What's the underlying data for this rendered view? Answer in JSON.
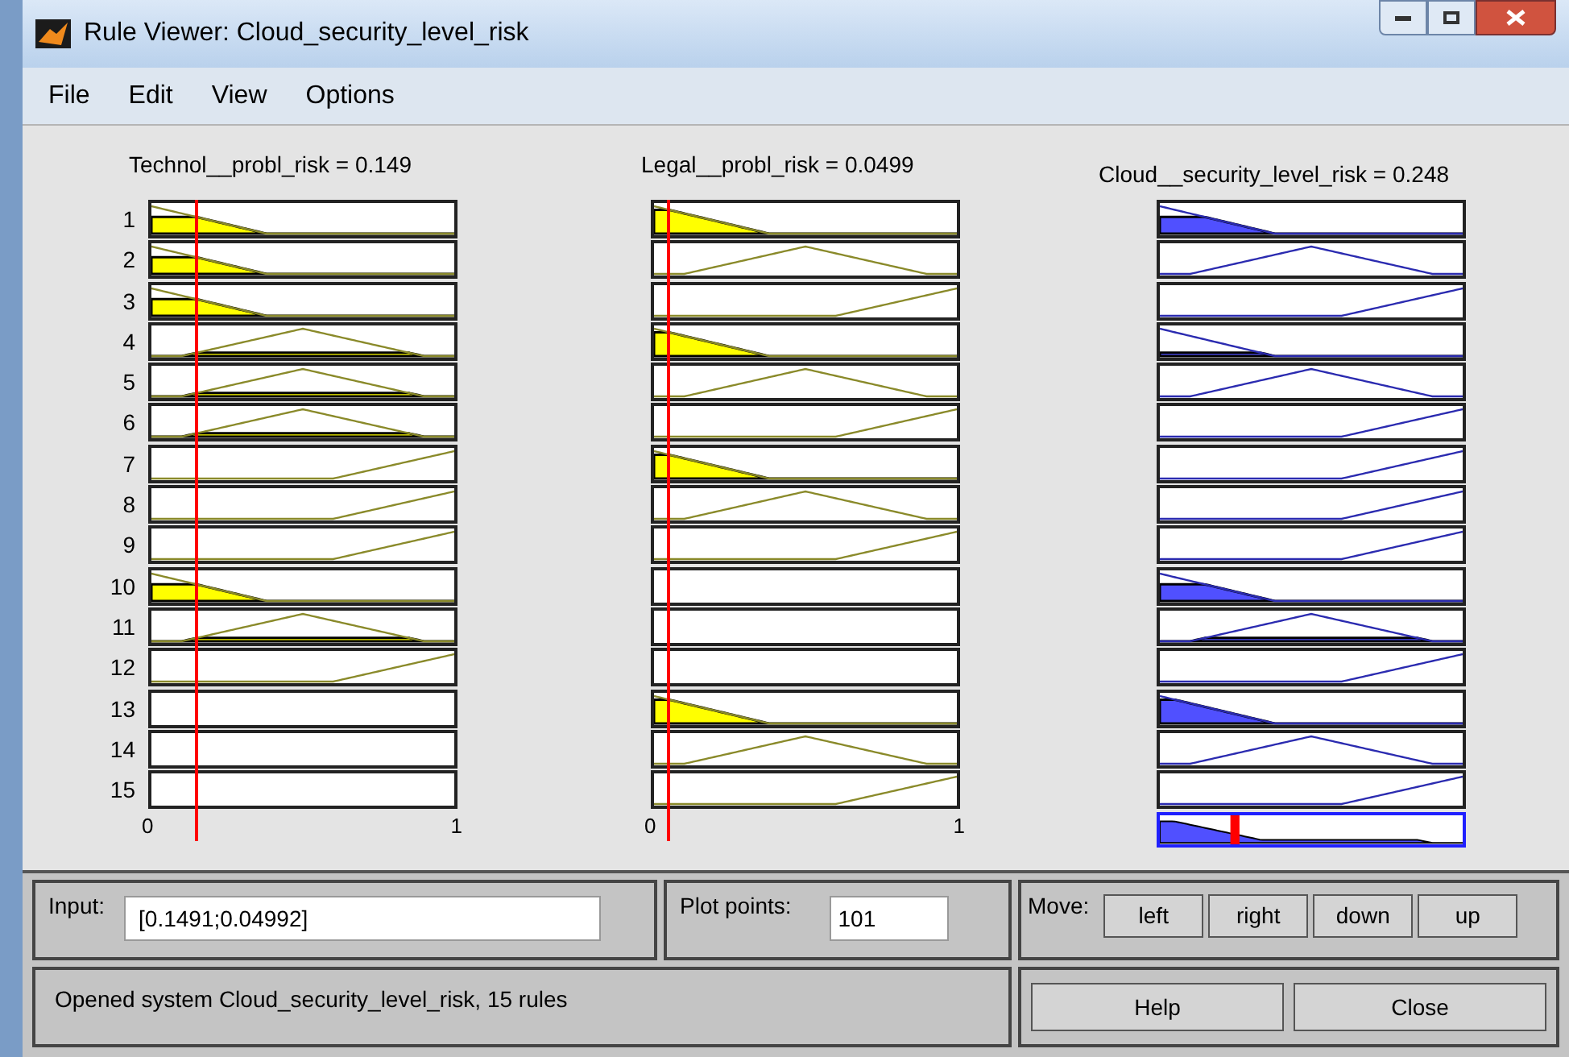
{
  "window": {
    "title": "Rule Viewer: Cloud_security_level_risk"
  },
  "menu": [
    "File",
    "Edit",
    "View",
    "Options"
  ],
  "variables": [
    {
      "title": "Technol__probl_risk = 0.149",
      "kind": "input"
    },
    {
      "title": "Legal__probl_risk = 0.0499",
      "kind": "input"
    },
    {
      "title": "Cloud__security_level_risk = 0.248",
      "kind": "output"
    }
  ],
  "rules": [
    {
      "number": "1",
      "cells": [
        {
          "kind": "low"
        },
        {
          "kind": "low"
        },
        {
          "kind": "low"
        }
      ]
    },
    {
      "number": "2",
      "cells": [
        {
          "kind": "low"
        },
        {
          "kind": "mid"
        },
        {
          "kind": "mid"
        }
      ]
    },
    {
      "number": "3",
      "cells": [
        {
          "kind": "low"
        },
        {
          "kind": "high"
        },
        {
          "kind": "high"
        }
      ]
    },
    {
      "number": "4",
      "cells": [
        {
          "kind": "mid"
        },
        {
          "kind": "low"
        },
        {
          "kind": "low"
        }
      ]
    },
    {
      "number": "5",
      "cells": [
        {
          "kind": "mid"
        },
        {
          "kind": "mid"
        },
        {
          "kind": "mid"
        }
      ]
    },
    {
      "number": "6",
      "cells": [
        {
          "kind": "mid"
        },
        {
          "kind": "high"
        },
        {
          "kind": "high"
        }
      ]
    },
    {
      "number": "7",
      "cells": [
        {
          "kind": "high"
        },
        {
          "kind": "low"
        },
        {
          "kind": "high"
        }
      ]
    },
    {
      "number": "8",
      "cells": [
        {
          "kind": "high"
        },
        {
          "kind": "mid"
        },
        {
          "kind": "high"
        }
      ]
    },
    {
      "number": "9",
      "cells": [
        {
          "kind": "high"
        },
        {
          "kind": "high"
        },
        {
          "kind": "high"
        }
      ]
    },
    {
      "number": "10",
      "cells": [
        {
          "kind": "low"
        },
        {
          "kind": "empty"
        },
        {
          "kind": "low"
        }
      ]
    },
    {
      "number": "11",
      "cells": [
        {
          "kind": "mid"
        },
        {
          "kind": "empty"
        },
        {
          "kind": "mid"
        }
      ]
    },
    {
      "number": "12",
      "cells": [
        {
          "kind": "high"
        },
        {
          "kind": "empty"
        },
        {
          "kind": "high"
        }
      ]
    },
    {
      "number": "13",
      "cells": [
        {
          "kind": "empty"
        },
        {
          "kind": "low"
        },
        {
          "kind": "low"
        }
      ]
    },
    {
      "number": "14",
      "cells": [
        {
          "kind": "empty"
        },
        {
          "kind": "mid"
        },
        {
          "kind": "mid"
        }
      ]
    },
    {
      "number": "15",
      "cells": [
        {
          "kind": "empty"
        },
        {
          "kind": "high"
        },
        {
          "kind": "high"
        }
      ]
    }
  ],
  "axis_labels": [
    {
      "min": "0",
      "max": "1"
    },
    {
      "min": "0",
      "max": "1"
    }
  ],
  "input": {
    "label": "Input:",
    "value": "[0.1491;0.04992]"
  },
  "plot_points": {
    "label": "Plot points:",
    "value": "101"
  },
  "move": {
    "label": "Move:",
    "buttons": [
      "left",
      "right",
      "down",
      "up"
    ]
  },
  "status": "Opened system Cloud_security_level_risk, 15 rules",
  "buttons": [
    "Help",
    "Close"
  ]
}
